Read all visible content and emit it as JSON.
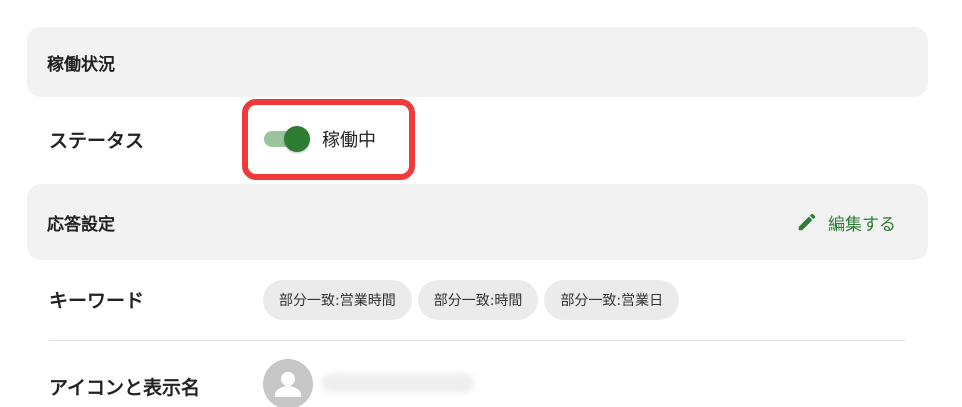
{
  "sections": {
    "status": {
      "title": "稼働状況",
      "status_label": "ステータス",
      "status_value": "稼働中",
      "toggle_on": true
    },
    "response": {
      "title": "応答設定",
      "edit_label": "編集する",
      "keyword_label": "キーワード",
      "keywords": [
        "部分一致:営業時間",
        "部分一致:時間",
        "部分一致:営業日"
      ],
      "icon_label": "アイコンと表示名"
    }
  },
  "icons": {
    "edit": "pencil-icon",
    "avatar": "person-icon"
  },
  "colors": {
    "accent": "#2e7d32",
    "highlight": "#f03a3a",
    "header_bg": "#f2f2f2",
    "chip_bg": "#ebebeb"
  }
}
